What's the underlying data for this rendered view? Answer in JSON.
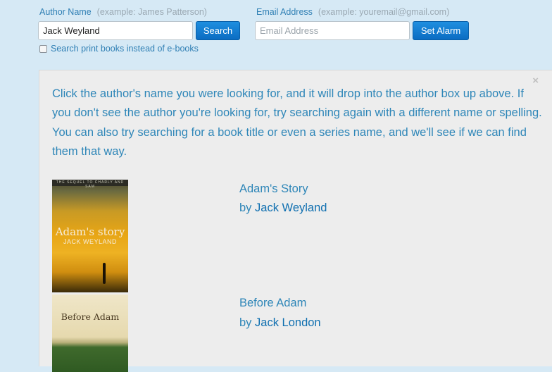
{
  "author": {
    "label": "Author Name",
    "hint": "(example: James Patterson)",
    "value": "Jack Weyland",
    "search_label": "Search"
  },
  "email": {
    "label": "Email Address",
    "hint": "(example: youremail@gmail.com)",
    "placeholder": "Email Address",
    "value": "",
    "button_label": "Set Alarm"
  },
  "print_option": {
    "label": "Search print books instead of e-books",
    "checked": false
  },
  "panel": {
    "close_glyph": "×",
    "message": "Click the author's name you were looking for, and it will drop into the author box up above. If you don't see the author you're looking for, try searching again with a different name or spelling. You can also try searching for a book title or even a series name, and we'll see if we can find them that way."
  },
  "results": [
    {
      "title": "Adam's Story",
      "by_prefix": "by",
      "author": "Jack Weyland",
      "cover": {
        "tagline": "THE SEQUEL TO CHARLY AND SAM",
        "title": "Adam's story",
        "author": "JACK WEYLAND"
      }
    },
    {
      "title": "Before Adam",
      "by_prefix": "by",
      "author": "Jack London",
      "cover": {
        "title": "Before Adam"
      }
    }
  ]
}
